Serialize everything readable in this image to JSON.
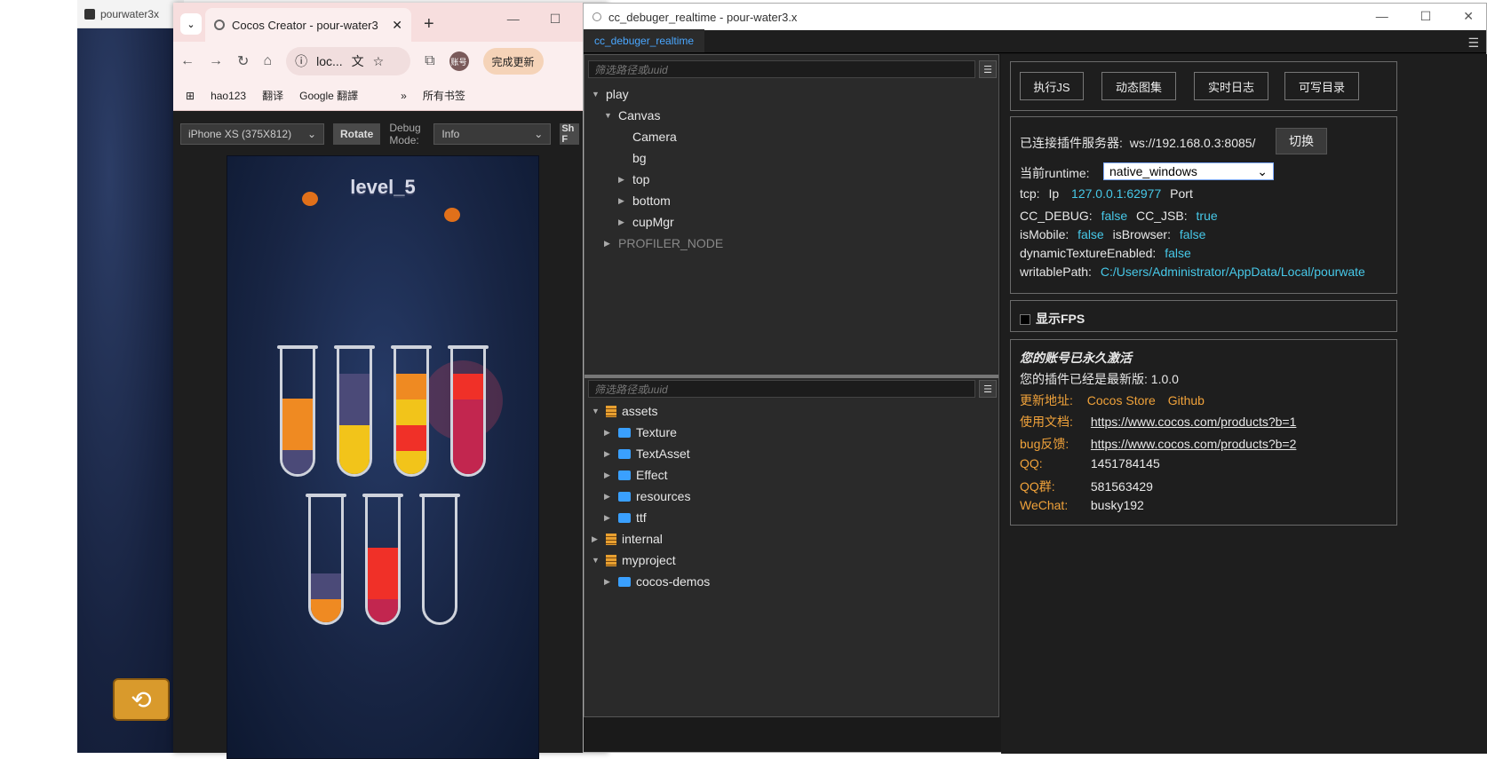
{
  "bg_window": {
    "title": "pourwater3x"
  },
  "chrome": {
    "tab_title": "Cocos Creator - pour-water3",
    "tab_close": "✕",
    "new_tab": "+",
    "omnibox_text": "loc...",
    "update_label": "完成更新",
    "avatar_label": "账号",
    "bookmarks": [
      "hao123",
      "翻译",
      "Google 翻譯"
    ],
    "bookmarks_overflow": "»",
    "all_bookmarks": "所有书签",
    "device_select": "iPhone XS (375X812)",
    "rotate_label": "Rotate",
    "debug_mode_label": "Debug Mode:",
    "debug_mode_value": "Info",
    "show_fps_partial": "Sh F",
    "level_text": "level_5",
    "win_controls": {
      "min": "—",
      "max": "☐",
      "close": "✕"
    }
  },
  "debugger": {
    "window_title": "cc_debuger_realtime - pour-water3.x",
    "tab_label": "cc_debuger_realtime",
    "menu_icon": "☰",
    "win_controls": {
      "min": "—",
      "max": "☐",
      "close": "✕"
    },
    "node_filter_placeholder": "筛选路径或uuid",
    "node_tree": [
      {
        "label": "play",
        "tri": "▼"
      },
      {
        "label": "Canvas",
        "tri": "▼"
      },
      {
        "label": "Camera",
        "tri": ""
      },
      {
        "label": "bg",
        "tri": ""
      },
      {
        "label": "top",
        "tri": "▶"
      },
      {
        "label": "bottom",
        "tri": "▶"
      },
      {
        "label": "cupMgr",
        "tri": "▶"
      },
      {
        "label": "PROFILER_NODE",
        "tri": "▶"
      }
    ],
    "asset_filter_placeholder": "筛选路径或uuid",
    "asset_tree": [
      {
        "label": "assets",
        "tri": "▼"
      },
      {
        "label": "Texture",
        "tri": "▶"
      },
      {
        "label": "TextAsset",
        "tri": "▶"
      },
      {
        "label": "Effect",
        "tri": "▶"
      },
      {
        "label": "resources",
        "tri": "▶"
      },
      {
        "label": "ttf",
        "tri": "▶"
      },
      {
        "label": "internal",
        "tri": "▶"
      },
      {
        "label": "myproject",
        "tri": "▼"
      },
      {
        "label": "cocos-demos",
        "tri": "▶"
      }
    ],
    "actions": [
      "执行JS",
      "动态图集",
      "实时日志",
      "可写目录"
    ],
    "server_label": "已连接插件服务器:",
    "server_value": "ws://192.168.0.3:8085/",
    "switch_label": "切换",
    "runtime_label": "当前runtime:",
    "runtime_value": "native_windows",
    "tcp_label": "tcp:",
    "ip_label": "Ip",
    "ip_value": "127.0.0.1:62977",
    "port_label": "Port",
    "cc_debug_label": "CC_DEBUG:",
    "cc_debug_value": "false",
    "cc_jsb_label": "CC_JSB:",
    "cc_jsb_value": "true",
    "is_mobile_label": "isMobile:",
    "is_mobile_value": "false",
    "is_browser_label": "isBrowser:",
    "is_browser_value": "false",
    "dyn_tex_label": "dynamicTextureEnabled:",
    "dyn_tex_value": "false",
    "writable_label": "writablePath:",
    "writable_value": "C:/Users/Administrator/AppData/Local/pourwate",
    "show_fps_label": "显示FPS",
    "account_status": "您的账号已永久激活",
    "version_text": "您的插件已经是最新版: 1.0.0",
    "update_label": "更新地址:",
    "update_links": [
      "Cocos Store",
      "Github"
    ],
    "docs_label": "使用文档:",
    "docs_link": "https://www.cocos.com/products?b=1",
    "bug_label": "bug反馈:",
    "bug_link": "https://www.cocos.com/products?b=2",
    "qq_label": "QQ:",
    "qq_value": "1451784145",
    "qq_group_label": "QQ群:",
    "qq_group_value": "581563429",
    "wechat_label": "WeChat:",
    "wechat_value": "busky192"
  },
  "colors": {
    "value_cyan": "#47c8e8",
    "label_orange": "#f0a23a",
    "tab_blue": "#4aa7ff",
    "orange_liquid": "#ef8a22",
    "navy_liquid": "#4b4a78",
    "yellow_liquid": "#f2c41a",
    "red_liquid": "#f03028",
    "crimson_liquid": "#c2264f"
  }
}
